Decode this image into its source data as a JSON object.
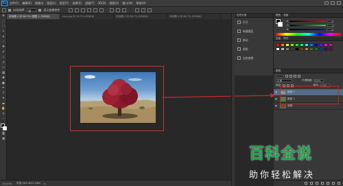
{
  "app": {
    "logo": "Ps"
  },
  "menubar": {
    "items": [
      "文件(F)",
      "编辑(E)",
      "图像(I)",
      "图层(L)",
      "类型(Y)",
      "选择(S)",
      "滤镜(T)",
      "3D(D)",
      "视图(V)",
      "窗口(W)",
      "帮助(H)"
    ]
  },
  "options": {
    "auto_select_label": "自动选择:",
    "target_value": "组",
    "transform_label": "显示变换控件"
  },
  "tabs": [
    {
      "label": "未标题-1 @ 66.7% (图层 1, RGB/8)"
    },
    {
      "label": "tree.jpg @ 16.7% (RGB/8)"
    },
    {
      "label": "未标题-2 @ 66.7% (RGB/8)"
    },
    {
      "label": "未标题-3 @ 66.7% (RGB/8)"
    }
  ],
  "history": {
    "items": [
      "历史记录",
      "打开",
      "新建图层",
      "移动",
      "粘贴",
      "自由变换"
    ]
  },
  "color_panel": {
    "tab1": "颜色",
    "tab2": "色板",
    "r_label": "R",
    "g_label": "G",
    "b_label": "B",
    "r_value": "0",
    "g_value": "0",
    "b_value": "0"
  },
  "swatches": {
    "tab1": "色板",
    "tab2": "样式",
    "colors": [
      "#ff0000",
      "#ff8000",
      "#ffff00",
      "#80ff00",
      "#00ff00",
      "#00ff80",
      "#00ffff",
      "#0080ff",
      "#0000ff",
      "#8000ff",
      "#ff00ff",
      "#ff0080",
      "#ffffff",
      "#c0c0c0",
      "#808080",
      "#404040",
      "#000000",
      "#804000",
      "#c08040",
      "#408000",
      "#008040",
      "#004080",
      "#400080",
      "#800040"
    ]
  },
  "layers_panel": {
    "title": "图层",
    "mode": "正常",
    "opacity_label": "不透明度:",
    "opacity_value": "100%",
    "lock_label": "锁定:",
    "fill_label": "填充:",
    "fill_value": "100%",
    "layers": [
      {
        "name": "图层 2"
      },
      {
        "name": "图层 1"
      },
      {
        "name": "背景"
      }
    ]
  },
  "statusbar": {
    "zoom": "33.33%",
    "doc_info": "文档:393.4K/1.18M"
  },
  "watermark": {
    "title": "百科全说",
    "subtitle": "助你轻松解决"
  }
}
